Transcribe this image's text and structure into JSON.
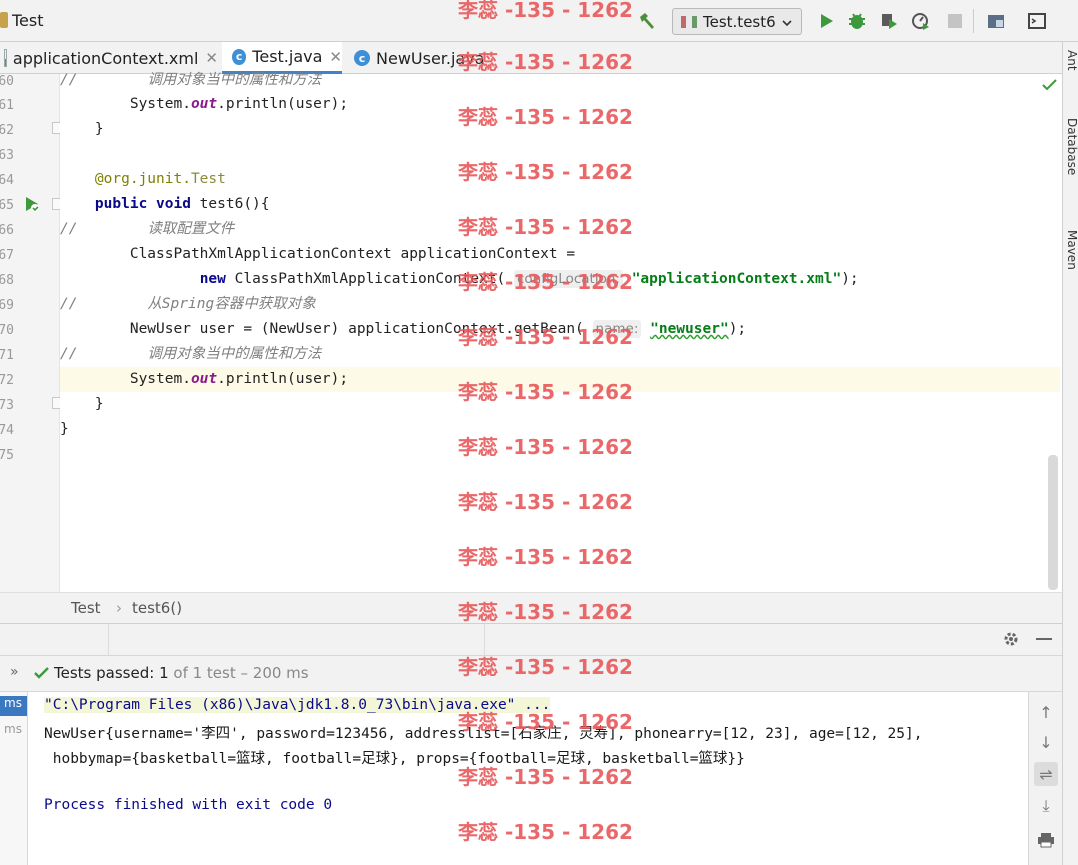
{
  "window": {
    "title": "Test"
  },
  "toolbar": {
    "run_config": "Test.test6",
    "icons": [
      "hammer-icon",
      "run-icon",
      "debug-icon",
      "coverage-icon",
      "profile-icon",
      "stop-icon",
      "project-structure-icon",
      "terminal-icon"
    ]
  },
  "tabs": [
    {
      "label": "applicationContext.xml",
      "icon": "xml-file-icon",
      "closable": true,
      "active": false
    },
    {
      "label": "Test.java",
      "icon": "class-c-icon",
      "closable": true,
      "active": true
    },
    {
      "label": "NewUser.java",
      "icon": "class-c-icon",
      "closable": false,
      "active": false
    }
  ],
  "right_strip": [
    "Ant",
    "Database",
    "Maven"
  ],
  "editor": {
    "line_numbers": [
      "60",
      "61",
      "62",
      "63",
      "64",
      "65",
      "66",
      "67",
      "68",
      "69",
      "70",
      "71",
      "72",
      "73",
      "74",
      "75"
    ],
    "lines": {
      "l60": {
        "prefix": "//",
        "comment": "调用对象当中的属性和方法"
      },
      "l61": {
        "a": "System.",
        "b": "out",
        "c": ".println(user);"
      },
      "l62": {
        "text": "}"
      },
      "l64": {
        "ann": "@org.junit.",
        "ann2": "Test"
      },
      "l65": {
        "kw": "public void",
        "rest": " test6(){"
      },
      "l66": {
        "prefix": "//",
        "comment": "读取配置文件"
      },
      "l67": {
        "text": "ClassPathXmlApplicationContext applicationContext ="
      },
      "l68": {
        "kw": "new",
        "rest": " ClassPathXmlApplicationContext(",
        "hint": "configLocation:",
        "str": "\"applicationContext.xml\"",
        "end": ");"
      },
      "l69": {
        "prefix": "//",
        "comment": "从Spring容器中获取对象"
      },
      "l70": {
        "rest": "NewUser user = (NewUser) applicationContext.getBean(",
        "hint": "name:",
        "str": "\"newuser\"",
        "end": ");"
      },
      "l71": {
        "prefix": "//",
        "comment": "调用对象当中的属性和方法"
      },
      "l72": {
        "a": "System.",
        "b": "out",
        "c": ".println(user);"
      },
      "l73": {
        "text": "}"
      },
      "l74": {
        "text": "}"
      }
    }
  },
  "breadcrumb": {
    "class": "Test",
    "sep": "›",
    "method": "test6()"
  },
  "run_panel": {
    "status_label": "Tests passed:",
    "passed": "1",
    "of_total": "of 1 test",
    "duration": "– 200 ms",
    "tree_times": [
      "ms",
      "ms"
    ],
    "console": [
      "\"C:\\Program Files (x86)\\Java\\jdk1.8.0_73\\bin\\java.exe\" ...",
      "NewUser{username='李四', password=123456, addresslist=[石家庄, 灵寿], phonearry=[12, 23], age=[12, 25],",
      " hobbymap={basketball=篮球, football=足球}, props={football=足球, basketball=篮球}}",
      "",
      "Process finished with exit code 0"
    ]
  },
  "watermark": "李蕊 -135 - 1262",
  "colors": {
    "accent": "#4083c9",
    "keyword": "#0a0a8a",
    "string": "#067d17",
    "comment": "#808080",
    "watermark": "#e8585a",
    "pass": "#3c9a3c"
  }
}
